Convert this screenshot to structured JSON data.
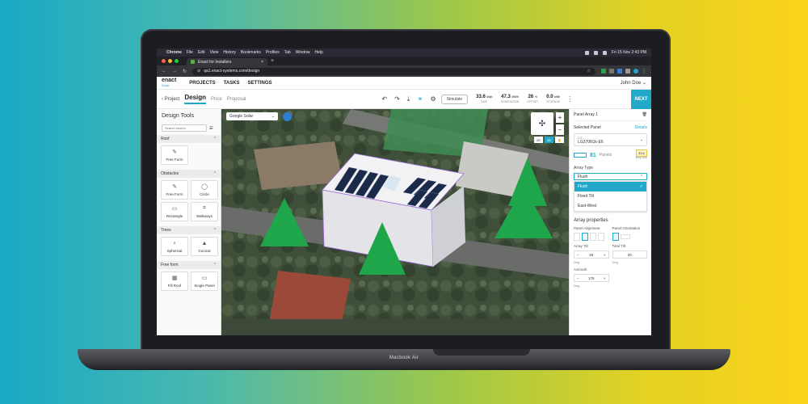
{
  "device_label": "Macbook Air",
  "menubar": {
    "app": "Chrome",
    "menus": [
      "File",
      "Edit",
      "View",
      "History",
      "Bookmarks",
      "Profiles",
      "Tab",
      "Window",
      "Help"
    ],
    "clock": "Fri 15 Nov  2:43 PM"
  },
  "browser": {
    "tab_title": "Enact for Installers",
    "url": "qa1.enact-systems.com/design"
  },
  "app": {
    "logo": "enact",
    "logo_sub": "Solar",
    "nav": [
      "PROJECTS",
      "TASKS",
      "SETTINGS"
    ],
    "user": "John Doe"
  },
  "toolbar": {
    "back": "Project",
    "tabs": [
      "Design",
      "Price",
      "Proposal"
    ],
    "simulate": "Simulate",
    "stats": [
      {
        "value": "33.6",
        "unit": "kWp",
        "label": "SIZE"
      },
      {
        "value": "47.3",
        "unit": "MWh",
        "label": "GENERATION"
      },
      {
        "value": "26",
        "unit": "%",
        "label": "OFFSET"
      },
      {
        "value": "0.0",
        "unit": "kWh",
        "label": "STORAGE"
      }
    ],
    "next": "NEXT"
  },
  "left": {
    "title": "Design Tools",
    "search_placeholder": "Search Assets",
    "sections": [
      {
        "name": "Roof",
        "tools": [
          "Free Form"
        ]
      },
      {
        "name": "Obstacles",
        "tools": [
          "Free Form",
          "Circle",
          "Rectangle",
          "Walkways"
        ]
      },
      {
        "name": "Trees",
        "tools": [
          "Spherical",
          "Conical"
        ]
      },
      {
        "name": "Free form",
        "tools": [
          "Fill Roof",
          "Single Panel"
        ]
      }
    ]
  },
  "map": {
    "source": "Google Solar",
    "modes": [
      "2D",
      "3D"
    ],
    "panel_count_on_roof": 81
  },
  "right": {
    "title": "Panel Array 1",
    "selected_panel_label": "Selected Panel",
    "details": "Details",
    "panel_brand": "LG",
    "panel_model": "LG370N1k-E6",
    "panels": "81",
    "panels_label": "Panels",
    "kw_value": "33.6",
    "kw_label": "kWp size",
    "array_type_label": "Array Type",
    "array_type_value": "Flush",
    "array_type_options": [
      "Flush",
      "Fixed Tilt",
      "East-West"
    ],
    "array_props": "Array properties",
    "panel_alignment": "Panel Alignment",
    "panel_orientation": "Panel Orientation",
    "array_tilt": "Array Tilt",
    "array_tilt_value": "20",
    "total_tilt": "Total Tilt",
    "total_tilt_value": "20",
    "deg": "Deg",
    "azimuth": "Azimuth",
    "azimuth_value": "176"
  }
}
